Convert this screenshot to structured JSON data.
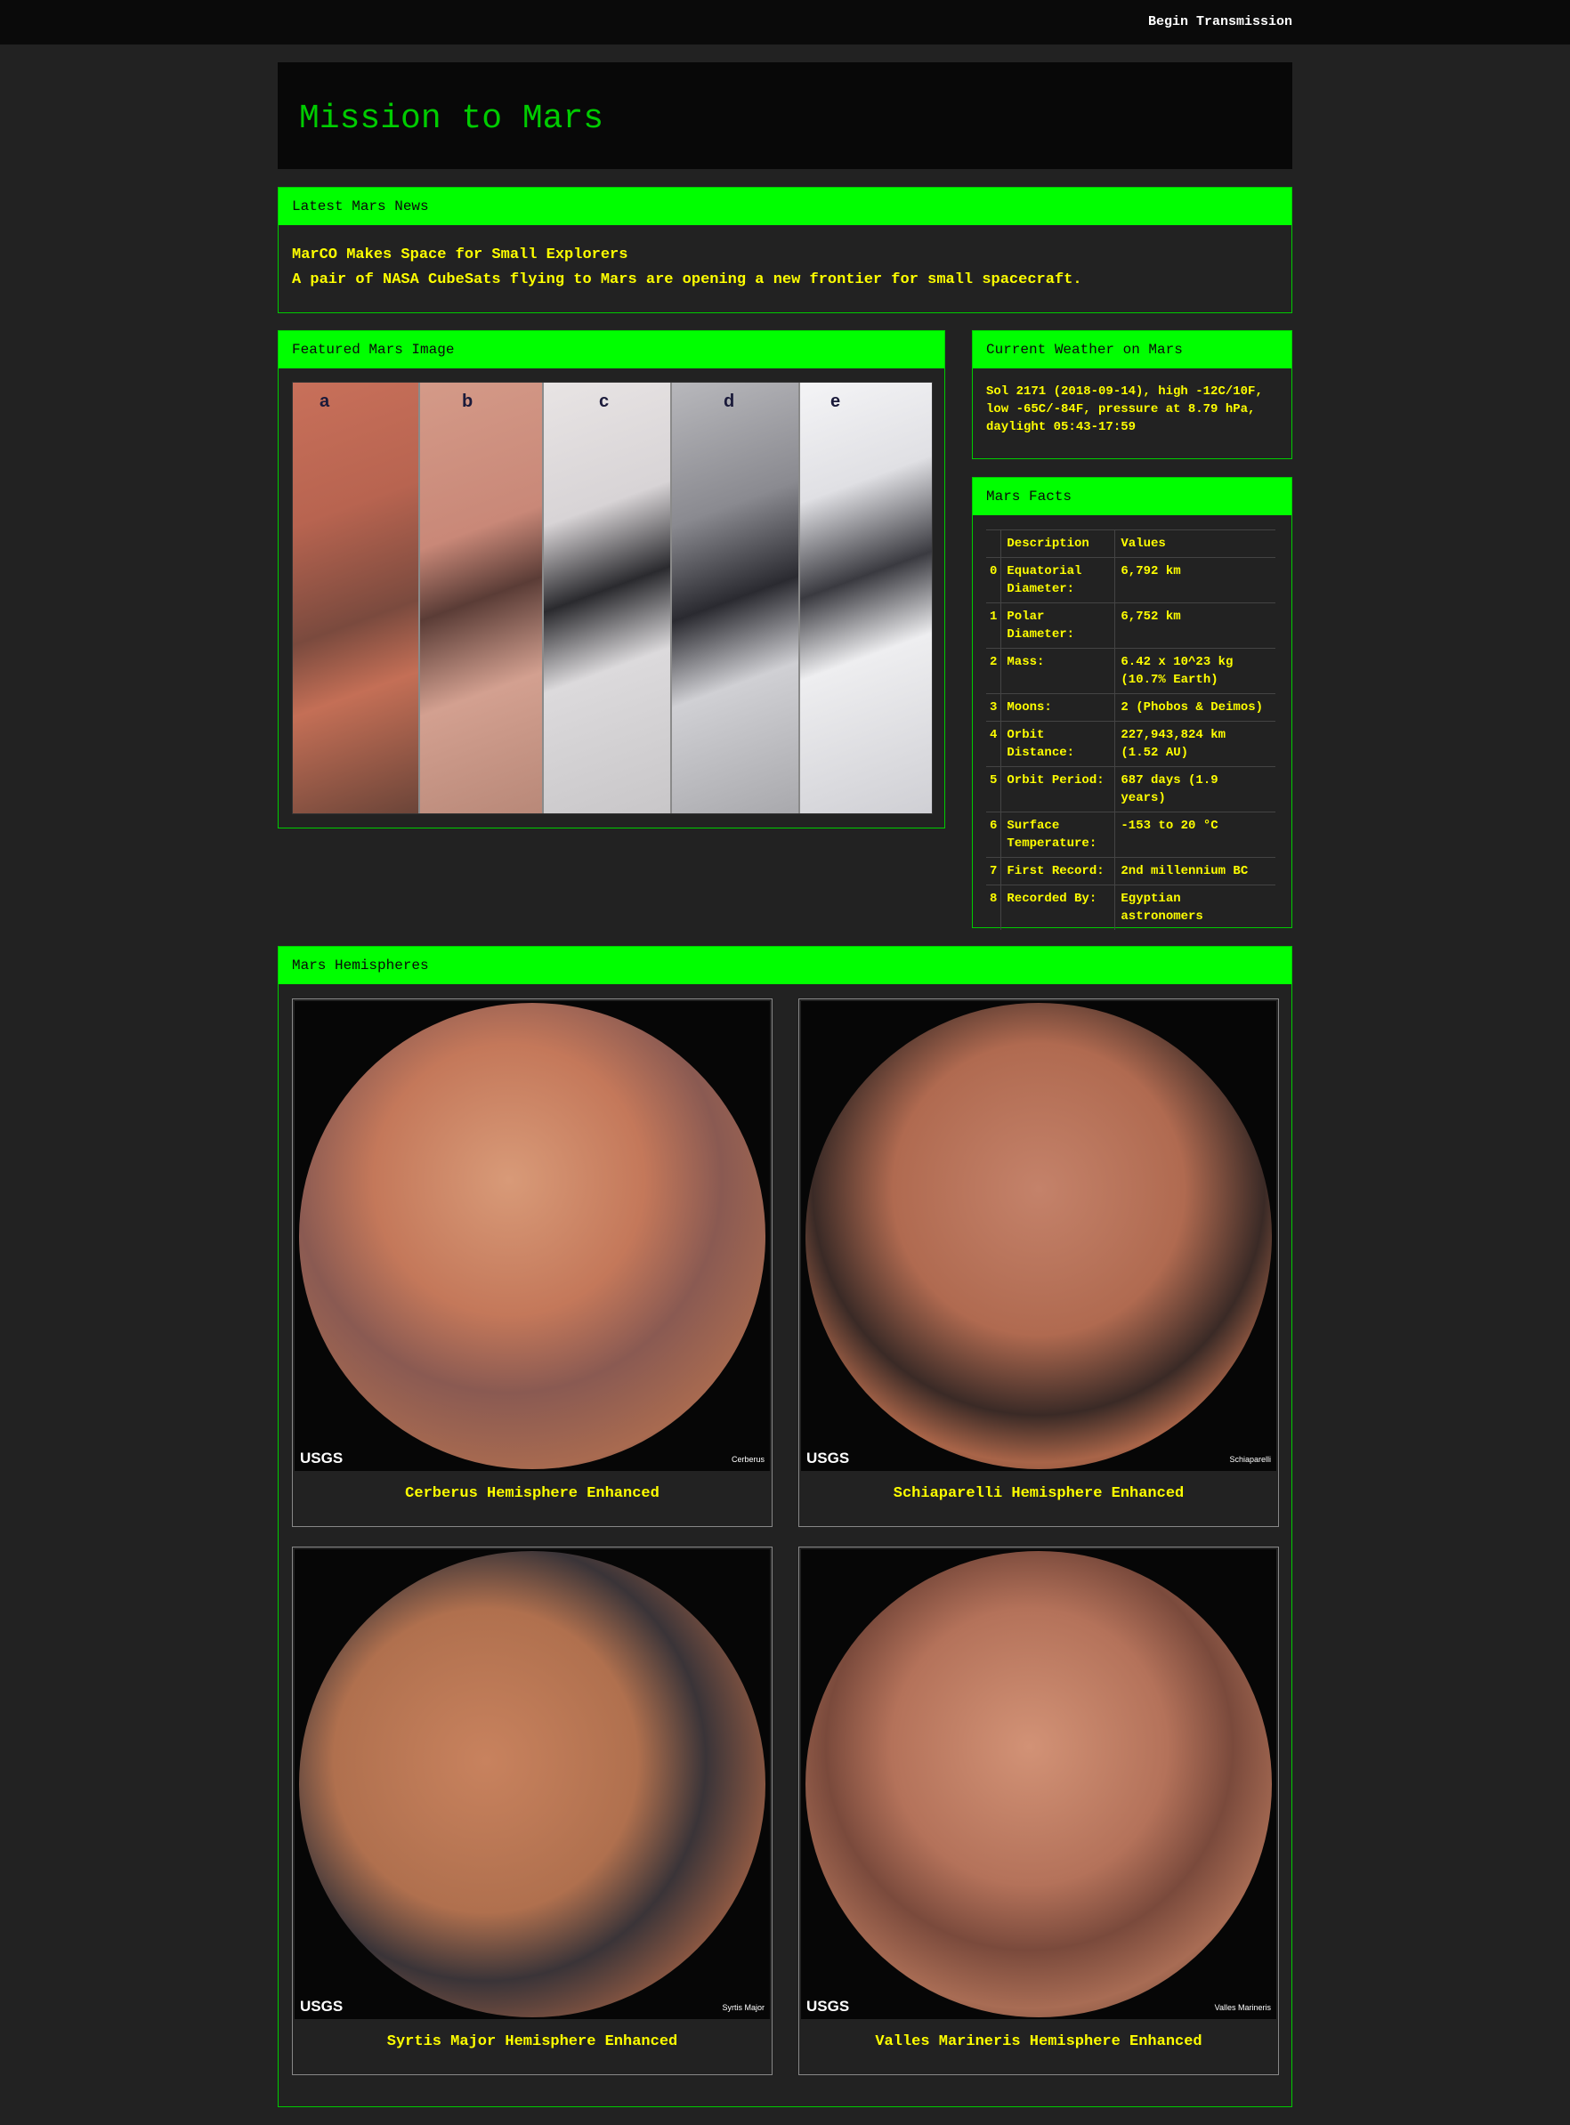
{
  "nav": {
    "link_label": "Begin Transmission"
  },
  "header": {
    "title": "Mission to Mars"
  },
  "news": {
    "heading": "Latest Mars News",
    "title": "MarCO Makes Space for Small Explorers",
    "teaser": "A pair of NASA CubeSats flying to Mars are opening a new frontier for small spacecraft."
  },
  "featured": {
    "heading": "Featured Mars Image",
    "panel_labels": [
      "a",
      "b",
      "c",
      "d",
      "e"
    ]
  },
  "weather": {
    "heading": "Current Weather on Mars",
    "text": "Sol 2171 (2018-09-14), high -12C/10F, low -65C/-84F, pressure at 8.79 hPa, daylight 05:43-17:59"
  },
  "facts": {
    "heading": "Mars Facts",
    "columns": [
      "Description",
      "Values"
    ],
    "rows": [
      {
        "idx": "0",
        "desc": "Equatorial Diameter:",
        "val": "6,792 km"
      },
      {
        "idx": "1",
        "desc": "Polar Diameter:",
        "val": "6,752 km"
      },
      {
        "idx": "2",
        "desc": "Mass:",
        "val": "6.42 x 10^23 kg (10.7% Earth)"
      },
      {
        "idx": "3",
        "desc": "Moons:",
        "val": "2 (Phobos & Deimos)"
      },
      {
        "idx": "4",
        "desc": "Orbit Distance:",
        "val": "227,943,824 km (1.52 AU)"
      },
      {
        "idx": "5",
        "desc": "Orbit Period:",
        "val": "687 days (1.9 years)"
      },
      {
        "idx": "6",
        "desc": "Surface Temperature:",
        "val": "-153 to 20 °C"
      },
      {
        "idx": "7",
        "desc": "First Record:",
        "val": "2nd millennium BC"
      },
      {
        "idx": "8",
        "desc": "Recorded By:",
        "val": "Egyptian astronomers"
      }
    ]
  },
  "hemispheres": {
    "heading": "Mars Hemispheres",
    "items": [
      {
        "title": "Cerberus Hemisphere Enhanced",
        "image_tag": "Cerberus",
        "logo": "USGS"
      },
      {
        "title": "Schiaparelli Hemisphere Enhanced",
        "image_tag": "Schiaparelli",
        "logo": "USGS"
      },
      {
        "title": "Syrtis Major Hemisphere Enhanced",
        "image_tag": "Syrtis Major",
        "logo": "USGS"
      },
      {
        "title": "Valles Marineris Hemisphere Enhanced",
        "image_tag": "Valles Marineris",
        "logo": "USGS"
      }
    ]
  },
  "colors": {
    "background": "#222222",
    "accent_green": "#00ff00",
    "border_green": "#00cc00",
    "text_yellow": "#ffff00"
  }
}
